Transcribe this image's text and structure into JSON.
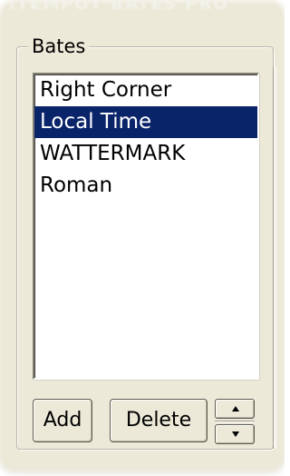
{
  "window": {
    "title_fragment": "ITEMPOT BATES PRO"
  },
  "group": {
    "label": "Bates"
  },
  "list": {
    "items": [
      {
        "label": "Right Corner",
        "selected": false
      },
      {
        "label": "Local Time",
        "selected": true
      },
      {
        "label": "WATTERMARK",
        "selected": false
      },
      {
        "label": "Roman",
        "selected": false
      }
    ]
  },
  "buttons": {
    "add_label": "Add",
    "delete_label": "Delete"
  },
  "icons": {
    "spin_up": "up-arrow-icon",
    "spin_down": "down-arrow-icon"
  },
  "colors": {
    "panel": "#ece9d8",
    "selection": "#0a246a",
    "selection_text": "#ffffff"
  }
}
